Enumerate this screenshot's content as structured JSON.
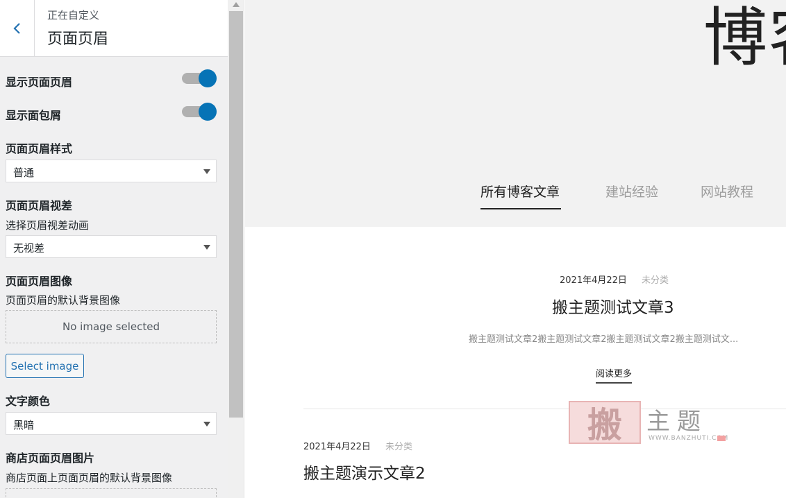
{
  "sidebar": {
    "subtitle": "正在自定义",
    "title": "页面页眉",
    "show_header_label": "显示页面页眉",
    "show_header_on": true,
    "show_breadcrumb_label": "显示面包屑",
    "show_breadcrumb_on": true,
    "header_style_label": "页面页眉样式",
    "header_style_value": "普通",
    "parallax_label": "页面页眉视差",
    "parallax_desc": "选择页眉视差动画",
    "parallax_value": "无视差",
    "header_image_label": "页面页眉图像",
    "header_image_desc": "页面页眉的默认背景图像",
    "no_image_text": "No image selected",
    "select_image_label": "Select image",
    "text_color_label": "文字颜色",
    "text_color_value": "黑暗",
    "shop_image_label": "商店页面页眉图片",
    "shop_image_desc": "商店页面上页面页眉的默认背景图像"
  },
  "preview": {
    "hero_title": "博客",
    "tabs": [
      {
        "label": "所有博客文章",
        "active": true
      },
      {
        "label": "建站经验",
        "active": false
      },
      {
        "label": "网站教程",
        "active": false
      }
    ],
    "posts": [
      {
        "date": "2021年4月22日",
        "category": "未分类",
        "title": "搬主题测试文章3",
        "excerpt": "搬主题测试文章2搬主题测试文章2搬主题测试文章2搬主题测试文...",
        "read_more": "阅读更多"
      },
      {
        "date": "2021年4月22日",
        "category": "未分类",
        "title": "搬主题演示文章2"
      }
    ],
    "watermark": {
      "seal": "搬",
      "text": "主题",
      "url": "WWW.BANZHUTI.COM"
    }
  },
  "colors": {
    "accent": "#0673b6",
    "link": "#2271b1",
    "sidebar_bg": "#f0f0f1",
    "hero_bg": "#f2f2f2"
  }
}
